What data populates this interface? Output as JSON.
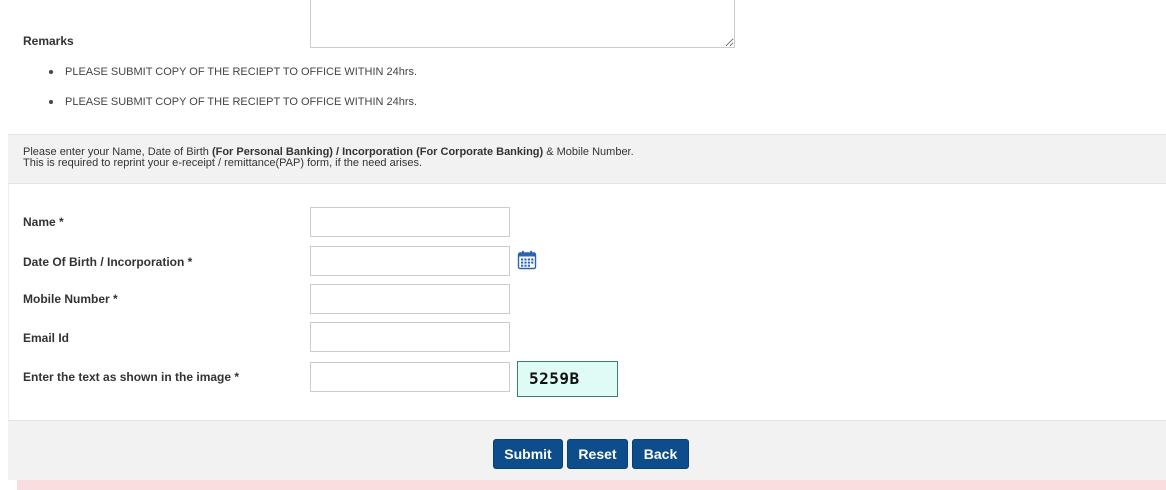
{
  "remarks": {
    "label": "Remarks",
    "value": ""
  },
  "notes": [
    "PLEASE SUBMIT COPY OF THE RECIEPT TO OFFICE WITHIN 24hrs.",
    "PLEASE SUBMIT COPY OF THE RECIEPT TO OFFICE WITHIN 24hrs."
  ],
  "info": {
    "line1_prefix": "Please enter your Name, Date of Birth ",
    "line1_bold": "(For Personal Banking) / Incorporation (For Corporate Banking)",
    "line1_suffix": " & Mobile Number.",
    "line2": "This is required to reprint your e-receipt / remittance(PAP) form, if the need arises."
  },
  "form": {
    "name_label": "Name *",
    "name_value": "",
    "dob_label": "Date Of Birth / Incorporation *",
    "dob_value": "",
    "mobile_label": "Mobile Number *",
    "mobile_value": "",
    "email_label": "Email Id",
    "email_value": "",
    "captcha_label": "Enter the text as shown in the image *",
    "captcha_value": "",
    "captcha_text": "5259B"
  },
  "icons": {
    "calendar": "calendar-icon"
  },
  "buttons": {
    "submit": "Submit",
    "reset": "Reset",
    "back": "Back"
  },
  "colors": {
    "button_bg": "#0d4d8b",
    "captcha_bg": "#dffbf6",
    "panel_bg": "#f2f2f2",
    "error_strip": "#f8dede"
  }
}
